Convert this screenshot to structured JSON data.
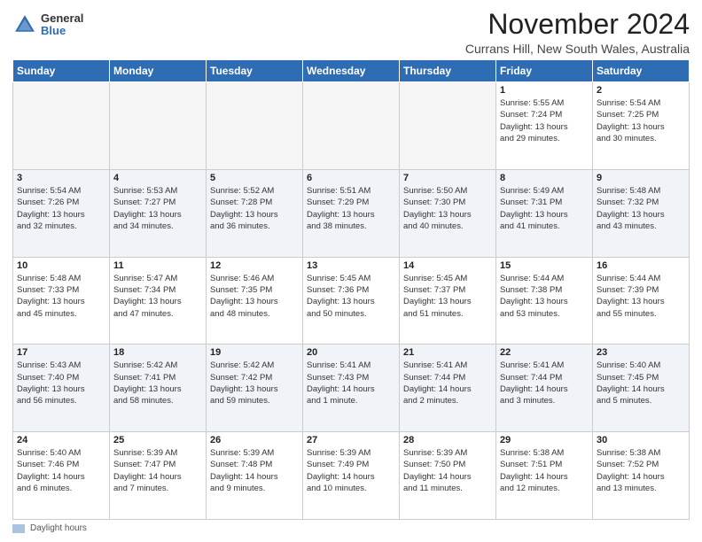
{
  "header": {
    "logo_general": "General",
    "logo_blue": "Blue",
    "month_title": "November 2024",
    "subtitle": "Currans Hill, New South Wales, Australia"
  },
  "days_of_week": [
    "Sunday",
    "Monday",
    "Tuesday",
    "Wednesday",
    "Thursday",
    "Friday",
    "Saturday"
  ],
  "weeks": [
    {
      "alt": false,
      "days": [
        {
          "num": "",
          "info": ""
        },
        {
          "num": "",
          "info": ""
        },
        {
          "num": "",
          "info": ""
        },
        {
          "num": "",
          "info": ""
        },
        {
          "num": "",
          "info": ""
        },
        {
          "num": "1",
          "info": "Sunrise: 5:55 AM\nSunset: 7:24 PM\nDaylight: 13 hours\nand 29 minutes."
        },
        {
          "num": "2",
          "info": "Sunrise: 5:54 AM\nSunset: 7:25 PM\nDaylight: 13 hours\nand 30 minutes."
        }
      ]
    },
    {
      "alt": true,
      "days": [
        {
          "num": "3",
          "info": "Sunrise: 5:54 AM\nSunset: 7:26 PM\nDaylight: 13 hours\nand 32 minutes."
        },
        {
          "num": "4",
          "info": "Sunrise: 5:53 AM\nSunset: 7:27 PM\nDaylight: 13 hours\nand 34 minutes."
        },
        {
          "num": "5",
          "info": "Sunrise: 5:52 AM\nSunset: 7:28 PM\nDaylight: 13 hours\nand 36 minutes."
        },
        {
          "num": "6",
          "info": "Sunrise: 5:51 AM\nSunset: 7:29 PM\nDaylight: 13 hours\nand 38 minutes."
        },
        {
          "num": "7",
          "info": "Sunrise: 5:50 AM\nSunset: 7:30 PM\nDaylight: 13 hours\nand 40 minutes."
        },
        {
          "num": "8",
          "info": "Sunrise: 5:49 AM\nSunset: 7:31 PM\nDaylight: 13 hours\nand 41 minutes."
        },
        {
          "num": "9",
          "info": "Sunrise: 5:48 AM\nSunset: 7:32 PM\nDaylight: 13 hours\nand 43 minutes."
        }
      ]
    },
    {
      "alt": false,
      "days": [
        {
          "num": "10",
          "info": "Sunrise: 5:48 AM\nSunset: 7:33 PM\nDaylight: 13 hours\nand 45 minutes."
        },
        {
          "num": "11",
          "info": "Sunrise: 5:47 AM\nSunset: 7:34 PM\nDaylight: 13 hours\nand 47 minutes."
        },
        {
          "num": "12",
          "info": "Sunrise: 5:46 AM\nSunset: 7:35 PM\nDaylight: 13 hours\nand 48 minutes."
        },
        {
          "num": "13",
          "info": "Sunrise: 5:45 AM\nSunset: 7:36 PM\nDaylight: 13 hours\nand 50 minutes."
        },
        {
          "num": "14",
          "info": "Sunrise: 5:45 AM\nSunset: 7:37 PM\nDaylight: 13 hours\nand 51 minutes."
        },
        {
          "num": "15",
          "info": "Sunrise: 5:44 AM\nSunset: 7:38 PM\nDaylight: 13 hours\nand 53 minutes."
        },
        {
          "num": "16",
          "info": "Sunrise: 5:44 AM\nSunset: 7:39 PM\nDaylight: 13 hours\nand 55 minutes."
        }
      ]
    },
    {
      "alt": true,
      "days": [
        {
          "num": "17",
          "info": "Sunrise: 5:43 AM\nSunset: 7:40 PM\nDaylight: 13 hours\nand 56 minutes."
        },
        {
          "num": "18",
          "info": "Sunrise: 5:42 AM\nSunset: 7:41 PM\nDaylight: 13 hours\nand 58 minutes."
        },
        {
          "num": "19",
          "info": "Sunrise: 5:42 AM\nSunset: 7:42 PM\nDaylight: 13 hours\nand 59 minutes."
        },
        {
          "num": "20",
          "info": "Sunrise: 5:41 AM\nSunset: 7:43 PM\nDaylight: 14 hours\nand 1 minute."
        },
        {
          "num": "21",
          "info": "Sunrise: 5:41 AM\nSunset: 7:44 PM\nDaylight: 14 hours\nand 2 minutes."
        },
        {
          "num": "22",
          "info": "Sunrise: 5:41 AM\nSunset: 7:44 PM\nDaylight: 14 hours\nand 3 minutes."
        },
        {
          "num": "23",
          "info": "Sunrise: 5:40 AM\nSunset: 7:45 PM\nDaylight: 14 hours\nand 5 minutes."
        }
      ]
    },
    {
      "alt": false,
      "days": [
        {
          "num": "24",
          "info": "Sunrise: 5:40 AM\nSunset: 7:46 PM\nDaylight: 14 hours\nand 6 minutes."
        },
        {
          "num": "25",
          "info": "Sunrise: 5:39 AM\nSunset: 7:47 PM\nDaylight: 14 hours\nand 7 minutes."
        },
        {
          "num": "26",
          "info": "Sunrise: 5:39 AM\nSunset: 7:48 PM\nDaylight: 14 hours\nand 9 minutes."
        },
        {
          "num": "27",
          "info": "Sunrise: 5:39 AM\nSunset: 7:49 PM\nDaylight: 14 hours\nand 10 minutes."
        },
        {
          "num": "28",
          "info": "Sunrise: 5:39 AM\nSunset: 7:50 PM\nDaylight: 14 hours\nand 11 minutes."
        },
        {
          "num": "29",
          "info": "Sunrise: 5:38 AM\nSunset: 7:51 PM\nDaylight: 14 hours\nand 12 minutes."
        },
        {
          "num": "30",
          "info": "Sunrise: 5:38 AM\nSunset: 7:52 PM\nDaylight: 14 hours\nand 13 minutes."
        }
      ]
    }
  ],
  "legend": {
    "daylight_label": "Daylight hours"
  }
}
